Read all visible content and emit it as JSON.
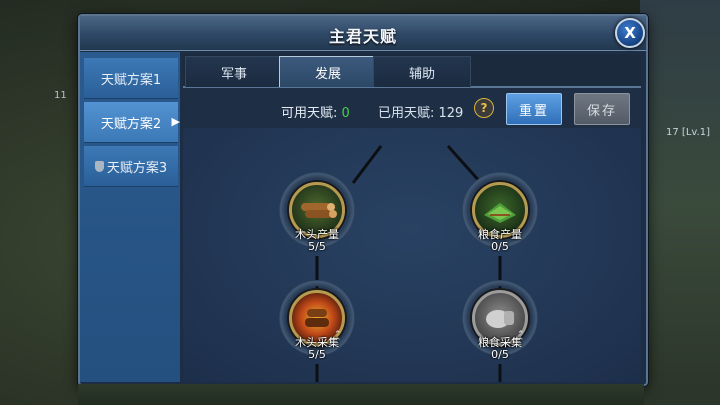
{
  "background": {
    "left_number": "11",
    "right_badge": "17 [Lv.1]"
  },
  "dialog": {
    "title": "主君天赋",
    "close_label": "X",
    "plans": [
      {
        "label": "天赋方案1",
        "active": false
      },
      {
        "label": "天赋方案2",
        "active": true
      },
      {
        "label": "天赋方案3",
        "active": false,
        "locked": true
      }
    ],
    "tabs": [
      {
        "label": "军事",
        "active": false
      },
      {
        "label": "发展",
        "active": true
      },
      {
        "label": "辅助",
        "active": false
      }
    ],
    "points": {
      "available_label": "可用天赋: ",
      "available_value": "0",
      "used_label": "已用天赋: 129"
    },
    "buttons": {
      "reset": "重置",
      "save": "保存"
    },
    "nodes": [
      {
        "name": "木头产量",
        "level": "5/5",
        "icon": "wood-log-icon"
      },
      {
        "name": "粮食产量",
        "level": "0/5",
        "icon": "farm-field-icon"
      },
      {
        "name": "木头采集",
        "level": "5/5",
        "icon": "wood-gather-icon"
      },
      {
        "name": "粮食采集",
        "level": "0/5",
        "icon": "food-gather-icon"
      }
    ],
    "colors": {
      "available_value": "#43d14a",
      "reset_button": "#2f6fb8",
      "save_button": "#535b66"
    }
  }
}
